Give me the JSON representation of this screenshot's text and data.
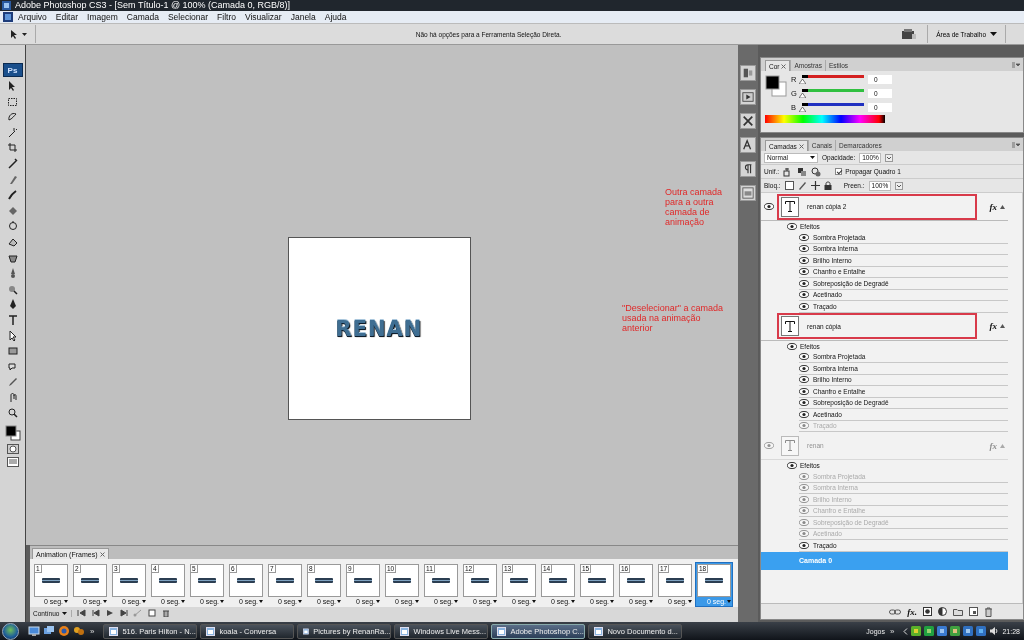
{
  "window": {
    "title": "Adobe Photoshop CS3 - [Sem Título-1 @ 100% (Camada 0, RGB/8)]"
  },
  "menu": [
    "Arquivo",
    "Editar",
    "Imagem",
    "Camada",
    "Selecionar",
    "Filtro",
    "Visualizar",
    "Janela",
    "Ajuda"
  ],
  "options_bar": {
    "message": "Não há opções para a Ferramenta Seleção Direta.",
    "workspace": "Área de Trabalho"
  },
  "toolbox": {
    "logo": "Ps"
  },
  "document": {
    "text": "RENAN"
  },
  "annotations": [
    {
      "text": "Outra camada para a outra camada de animação",
      "kind": "upper"
    },
    {
      "text": "\"Deselecionar\" a camada usada na animação anterior",
      "kind": "lower"
    }
  ],
  "color_panel": {
    "tabs": [
      {
        "label": "Cor",
        "selected": true
      },
      {
        "label": "Amostras",
        "selected": false
      },
      {
        "label": "Estilos",
        "selected": false
      }
    ],
    "channels": [
      {
        "label": "R",
        "value": "0",
        "level": 0,
        "color": "#d42020"
      },
      {
        "label": "G",
        "value": "0",
        "level": 0,
        "color": "#30c040"
      },
      {
        "label": "B",
        "value": "0",
        "level": 0,
        "color": "#2030c0"
      }
    ]
  },
  "layers_panel": {
    "tabs": [
      {
        "label": "Camadas",
        "selected": true
      },
      {
        "label": "Canais",
        "selected": false
      },
      {
        "label": "Demarcadores",
        "selected": false
      }
    ],
    "blend_mode": "Normal",
    "opacity_label": "Opacidade:",
    "opacity": "100%",
    "unify_label": "Unif.:",
    "propagate": {
      "label": "Propagar Quadro 1",
      "checked": true
    },
    "lock_label": "Bloq.:",
    "fill_label": "Preen.:",
    "fill": "100%",
    "layers": [
      {
        "name": "renan cópia 2",
        "visible": true,
        "highlighted": true,
        "faded": false,
        "fx": "fx",
        "effects_label": "Efeitos",
        "effects": [
          {
            "name": "Sombra Projetada",
            "faded": false
          },
          {
            "name": "Sombra Interna",
            "faded": false
          },
          {
            "name": "Brilho Interno",
            "faded": false
          },
          {
            "name": "Chanfro e Entalhe",
            "faded": false
          },
          {
            "name": "Sobreposição de Degradê",
            "faded": false
          },
          {
            "name": "Acetinado",
            "faded": false
          },
          {
            "name": "Traçado",
            "faded": false
          }
        ]
      },
      {
        "name": "renan cópia",
        "visible": false,
        "highlighted": true,
        "faded": false,
        "fx": "fx",
        "effects_label": "Efeitos",
        "effects": [
          {
            "name": "Sombra Projetada",
            "faded": false
          },
          {
            "name": "Sombra Interna",
            "faded": false
          },
          {
            "name": "Brilho Interno",
            "faded": false
          },
          {
            "name": "Chanfro e Entalhe",
            "faded": false
          },
          {
            "name": "Sobreposição de Degradê",
            "faded": false
          },
          {
            "name": "Acetinado",
            "faded": false
          },
          {
            "name": "Traçado",
            "faded": true
          }
        ]
      },
      {
        "name": "renan",
        "visible": true,
        "highlighted": false,
        "faded": true,
        "fx": "fx",
        "effects_label": "Efeitos",
        "effects": [
          {
            "name": "Sombra Projetada",
            "faded": true
          },
          {
            "name": "Sombra Interna",
            "faded": true
          },
          {
            "name": "Brilho Interno",
            "faded": true
          },
          {
            "name": "Chanfro e Entalhe",
            "faded": true
          },
          {
            "name": "Sobreposição de Degradê",
            "faded": true
          },
          {
            "name": "Acetinado",
            "faded": true
          },
          {
            "name": "Traçado",
            "faded": false
          }
        ]
      }
    ],
    "base_layer": {
      "name": "Camada 0",
      "selected": true
    },
    "footer_fx": "fx."
  },
  "animation_panel": {
    "tab": "Animation (Frames)",
    "loop": "Contínuo",
    "frames": [
      {
        "number": "1",
        "delay": "0 seg.",
        "selected": false
      },
      {
        "number": "2",
        "delay": "0 seg.",
        "selected": false
      },
      {
        "number": "3",
        "delay": "0 seg.",
        "selected": false
      },
      {
        "number": "4",
        "delay": "0 seg.",
        "selected": false
      },
      {
        "number": "5",
        "delay": "0 seg.",
        "selected": false
      },
      {
        "number": "6",
        "delay": "0 seg.",
        "selected": false
      },
      {
        "number": "7",
        "delay": "0 seg.",
        "selected": false
      },
      {
        "number": "8",
        "delay": "0 seg.",
        "selected": false
      },
      {
        "number": "9",
        "delay": "0 seg.",
        "selected": false
      },
      {
        "number": "10",
        "delay": "0 seg.",
        "selected": false
      },
      {
        "number": "11",
        "delay": "0 seg.",
        "selected": false
      },
      {
        "number": "12",
        "delay": "0 seg.",
        "selected": false
      },
      {
        "number": "13",
        "delay": "0 seg.",
        "selected": false
      },
      {
        "number": "14",
        "delay": "0 seg.",
        "selected": false
      },
      {
        "number": "15",
        "delay": "0 seg.",
        "selected": false
      },
      {
        "number": "16",
        "delay": "0 seg.",
        "selected": false
      },
      {
        "number": "17",
        "delay": "0 seg.",
        "selected": false
      },
      {
        "number": "18",
        "delay": "0 seg.",
        "selected": true
      }
    ]
  },
  "taskbar": {
    "overflow": "»",
    "tasks": [
      {
        "label": "516. Paris Hilton - N...",
        "selected": false
      },
      {
        "label": "koala - Conversa",
        "selected": false
      },
      {
        "label": "Pictures by RenanRa...",
        "selected": false
      },
      {
        "label": "Windows Live Mess...",
        "selected": false
      },
      {
        "label": "Adobe Photoshop C...",
        "selected": true
      },
      {
        "label": "Novo Documento d...",
        "selected": false
      }
    ],
    "toolbar_label": "Jogos",
    "toolbar_overflow": "»",
    "clock": "21:28"
  }
}
